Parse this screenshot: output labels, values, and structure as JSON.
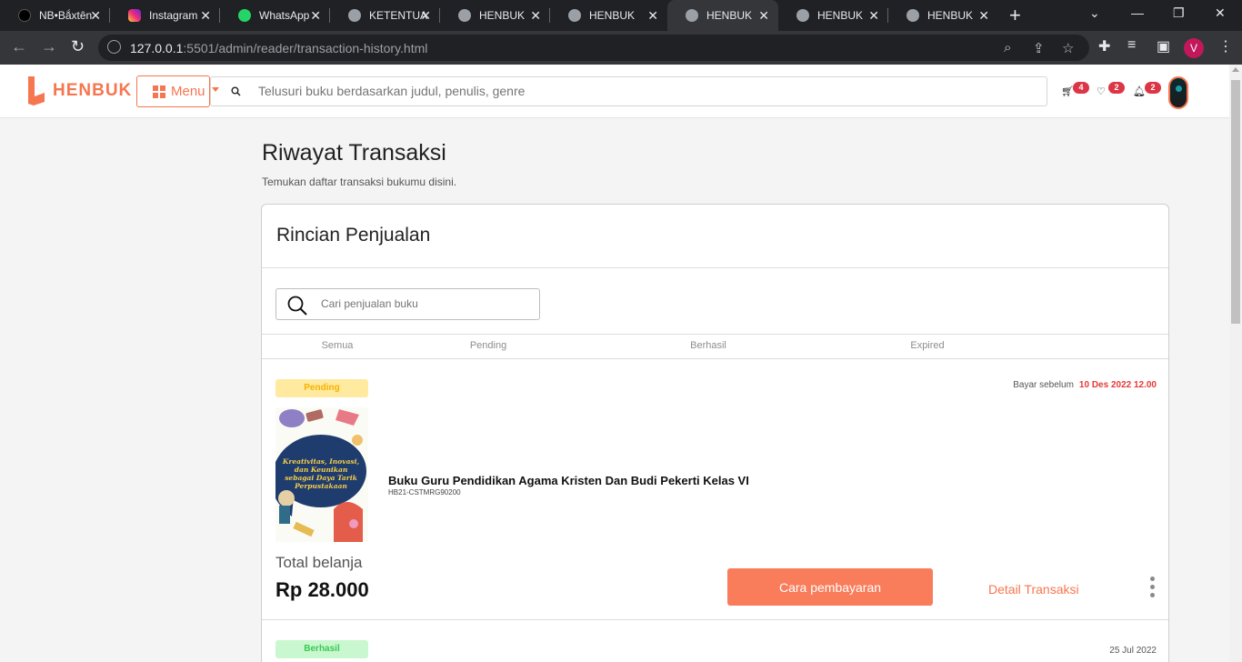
{
  "browser": {
    "tabs": [
      {
        "title": "NB•Bắxtên",
        "icon": "tiktok-icon"
      },
      {
        "title": "Instagram",
        "icon": "instagram-icon"
      },
      {
        "title": "WhatsApp",
        "icon": "whatsapp-icon"
      },
      {
        "title": "KETENTUA",
        "icon": "globe-icon"
      },
      {
        "title": "HENBUK",
        "icon": "globe-icon"
      },
      {
        "title": "HENBUK",
        "icon": "globe-icon"
      },
      {
        "title": "HENBUK",
        "icon": "globe-icon",
        "active": true
      },
      {
        "title": "HENBUK",
        "icon": "globe-icon"
      },
      {
        "title": "HENBUK",
        "icon": "globe-icon"
      }
    ],
    "url_host": "127.0.0.1",
    "url_rest": ":5501/admin/reader/transaction-history.html",
    "profile_initial": "V"
  },
  "header": {
    "logo_text": "HENBUK",
    "menu_label": "Menu",
    "search_placeholder": "Telusuri buku berdasarkan judul, penulis, genre",
    "cart_count": "4",
    "wishlist_count": "2",
    "notification_count": "2"
  },
  "page": {
    "title": "Riwayat Transaksi",
    "subtitle": "Temukan daftar transaksi bukumu disini."
  },
  "card": {
    "title": "Rincian Penjualan",
    "search_placeholder": "Cari penjualan buku",
    "tabs": [
      "Semua",
      "Pending",
      "Berhasil",
      "Expired"
    ]
  },
  "transactions": [
    {
      "status": "Pending",
      "pay_before_label": "Bayar sebelum",
      "pay_before_date": "10 Des 2022 12.00",
      "cover_title": "Kreativitas, Inovasi, dan Keunikan sebagai Daya Tarik Perpustakaan",
      "book_title": "Buku Guru Pendidikan Agama Kristen Dan Budi Pekerti Kelas VI",
      "book_code": "HB21-CSTMRG90200",
      "total_label": "Total belanja",
      "total_value": "Rp 28.000",
      "pay_button": "Cara pembayaran",
      "detail_link": "Detail Transaksi"
    },
    {
      "status": "Berhasil",
      "date": "25 Jul 2022"
    }
  ],
  "colors": {
    "brand": "#f6764f",
    "pay_button": "#f97c5b",
    "deadline": "#e53935",
    "pending_bg": "#ffeaa0",
    "pending_text": "#f7b200",
    "success_bg": "#c9f7cf",
    "success_text": "#39c952"
  }
}
